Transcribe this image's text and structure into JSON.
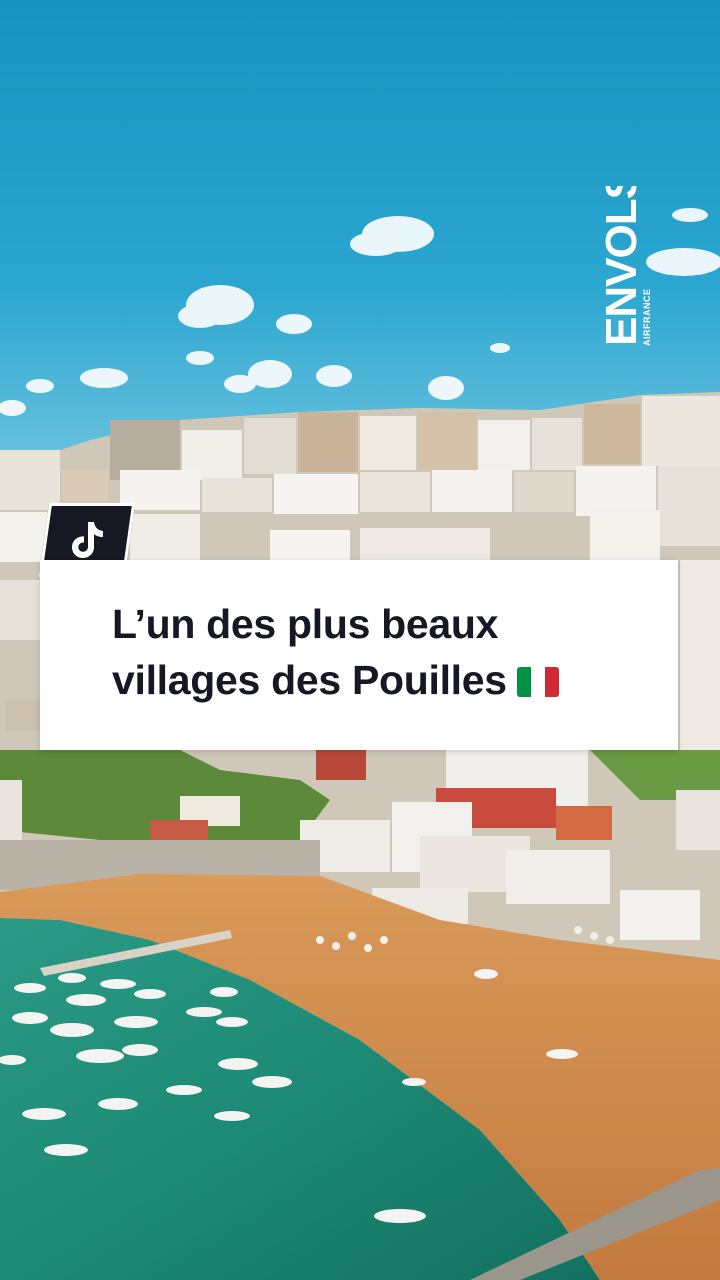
{
  "video": {
    "caption_line1": "L’un des plus beaux",
    "caption_line2": "villages des Pouilles",
    "caption_emoji": "italy-flag"
  },
  "watermark": {
    "brand": "ENVOLS",
    "sub": "AIRFRANCE"
  },
  "badge": {
    "icon": "tiktok-icon"
  },
  "colors": {
    "sky_top": "#1f9fc6",
    "sky_bottom": "#5cc0e0",
    "sea": "#1f8f77",
    "sand": "#d08a4d",
    "caption_text": "#161823",
    "caption_bg": "#ffffff",
    "flag_green": "#009246",
    "flag_white": "#ffffff",
    "flag_red": "#ce2b37"
  }
}
